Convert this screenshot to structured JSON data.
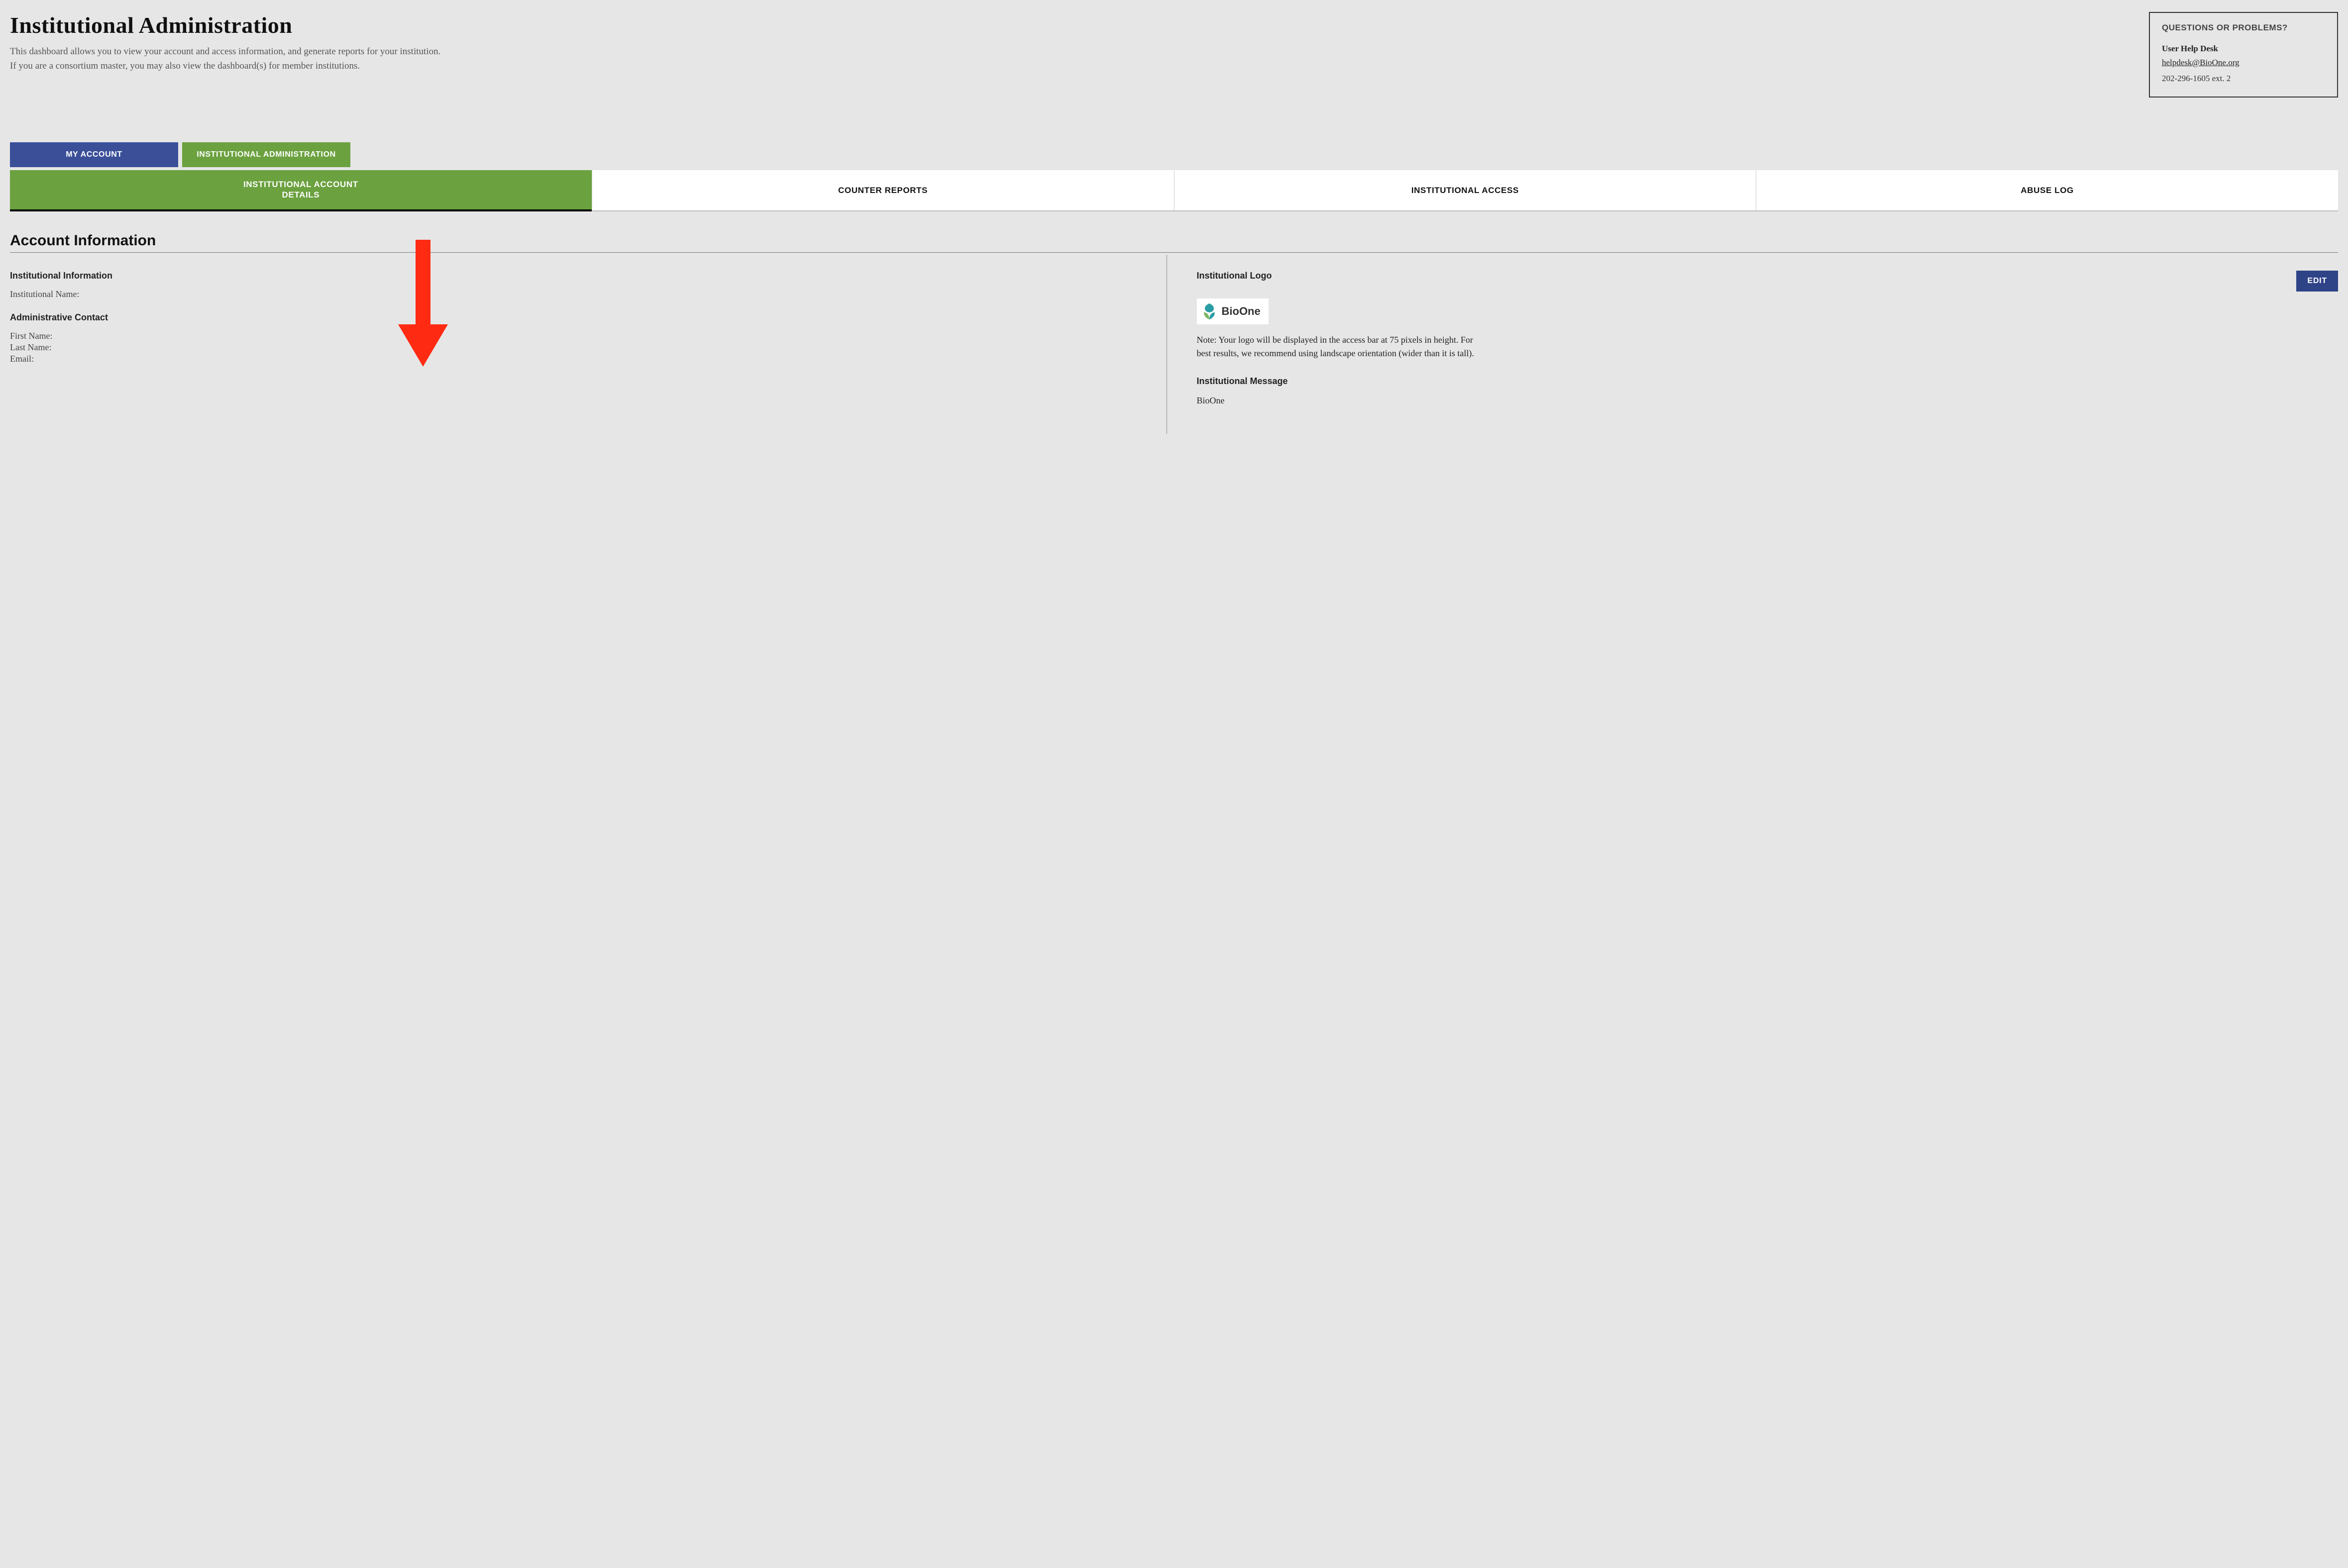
{
  "header": {
    "title": "Institutional Administration",
    "description": "This dashboard allows you to view your account and access information, and generate reports for your institution. If you are a consortium master, you may also view the dashboard(s) for member institutions."
  },
  "help_box": {
    "title": "QUESTIONS OR PROBLEMS?",
    "desk_label": "User Help Desk",
    "email": "helpdesk@BioOne.org",
    "phone": "202-296-1605 ext. 2"
  },
  "nav": {
    "my_account": "MY ACCOUNT",
    "inst_admin": "INSTITUTIONAL ADMINISTRATION"
  },
  "tabs": [
    {
      "label": "INSTITUTIONAL ACCOUNT DETAILS",
      "active": true
    },
    {
      "label": "COUNTER REPORTS",
      "active": false
    },
    {
      "label": "INSTITUTIONAL ACCESS",
      "active": false
    },
    {
      "label": "ABUSE LOG",
      "active": false
    }
  ],
  "section": {
    "title": "Account Information",
    "left": {
      "info_heading": "Institutional Information",
      "inst_name_label": "Institutional Name:",
      "admin_heading": "Administrative Contact",
      "first_name_label": "First Name:",
      "last_name_label": "Last Name:",
      "email_label": "Email:"
    },
    "right": {
      "logo_heading": "Institutional Logo",
      "edit_label": "EDIT",
      "logo_text": "BioOne",
      "note": "Note: Your logo will be displayed in the access bar at 75 pixels in height. For best results, we recommend using landscape orientation (wider than it is tall).",
      "msg_heading": "Institutional Message",
      "msg_value": "BioOne"
    }
  }
}
